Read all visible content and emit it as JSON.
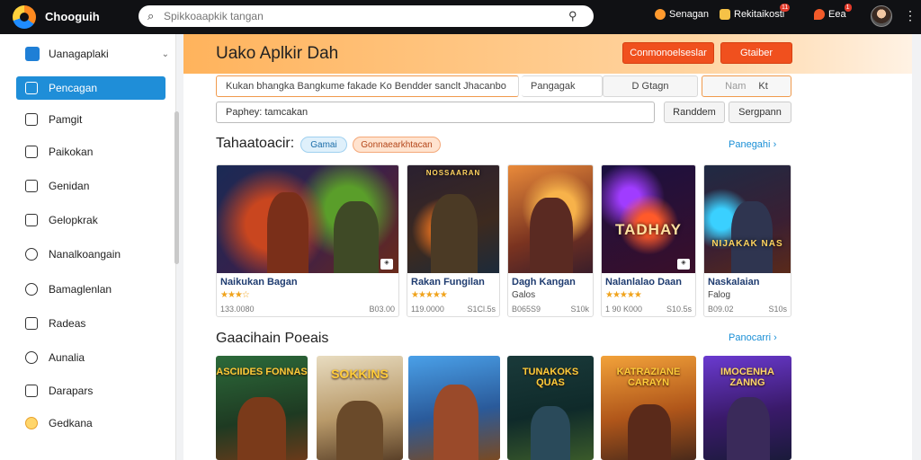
{
  "app": {
    "brand": "Chooguih"
  },
  "search": {
    "placeholder": "Spikkoaapkik tangan"
  },
  "topbar": {
    "items": [
      {
        "label": "Senagan"
      },
      {
        "label": "Rekitaikosti",
        "badge": "11"
      },
      {
        "label": "Eea",
        "badge": "1"
      }
    ]
  },
  "sidebar": {
    "header": "Uanagaplaki",
    "items": [
      {
        "label": "Pencagan",
        "icon": "edit-icon",
        "active": true
      },
      {
        "label": "Pamgit",
        "icon": "card-icon"
      },
      {
        "label": "Paikokan",
        "icon": "doc-icon"
      },
      {
        "label": "Genidan",
        "icon": "folder-icon"
      },
      {
        "label": "Gelopkrak",
        "icon": "home-icon"
      },
      {
        "label": "Nanalkoangain",
        "icon": "key-icon"
      },
      {
        "label": "Bamaglenlan",
        "icon": "user-icon"
      },
      {
        "label": "Radeas",
        "icon": "tag-icon"
      },
      {
        "label": "Aunalia",
        "icon": "clock-icon"
      },
      {
        "label": "Darapars",
        "icon": "box-icon"
      },
      {
        "label": "Gedkana",
        "icon": "smile-icon"
      }
    ]
  },
  "main": {
    "title": "Uako Aplkir Dah",
    "buttons": {
      "primary": "Conmonoelseslar",
      "secondary": "Gtaiber"
    },
    "filters": {
      "text": "Kukan bhangka  Bangkume fakade Ko Bendder sanclt Jhacanbo",
      "f2": "Pangagak",
      "f3": "D Gtagn",
      "f4a": "Nam",
      "f4b": "Kt"
    },
    "search2": {
      "value": "Paphey: tamcakan"
    },
    "btn_random": "Randdem",
    "btn_sort": "Sergpann",
    "section1": {
      "title": "Tahaatoacir:",
      "pills": [
        "Gamai",
        "Gonnaearkhtacan"
      ],
      "see_all": "Panegahi"
    },
    "cards": [
      {
        "name": "Naikukan Bagan",
        "rating": "★★★☆",
        "reviews": "133.0080",
        "price": "B03.00"
      },
      {
        "name": "Rakan Fungilan",
        "rating": "★★★★★",
        "reviews": "119.0000",
        "price": "S1Cl.5s"
      },
      {
        "name": "Dagh Kangan",
        "sub": "Galos",
        "reviews": "B065S9",
        "price": "S10k"
      },
      {
        "name": "Nalanlalao Daan",
        "rating": "★★★★★",
        "reviews": "1 90 K000",
        "price": "S10.5s"
      },
      {
        "name": "Naskalaian",
        "sub": "Falog",
        "reviews": "B09.02",
        "price": "S10s"
      }
    ],
    "card_art": [
      "",
      "NOSSAARAN",
      "",
      "TADHAY",
      "NIJAKAK NAS"
    ],
    "section2": {
      "title": "Gaacihain Poeais",
      "see_all": "Panocarri"
    },
    "tiles": [
      "ASCIIDES FONNAS",
      "SOKKINS",
      "",
      "TUNAKOKS QUAS",
      "KATRAZIANE CARAYN",
      "IMOCENHA ZANNG"
    ]
  },
  "colors": {
    "accent": "#1f8ed8",
    "brand_orange": "#f0501e",
    "topbar": "#101114"
  }
}
